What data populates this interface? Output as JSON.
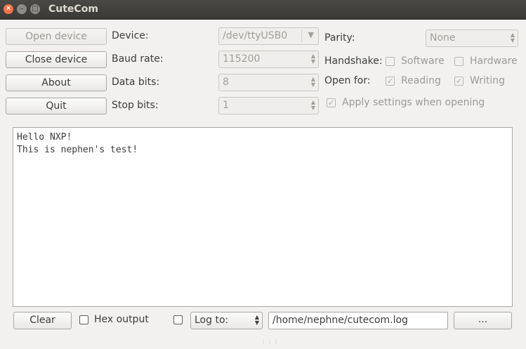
{
  "window": {
    "title": "CuteCom"
  },
  "buttons": {
    "open_device": "Open device",
    "close_device": "Close device",
    "about": "About",
    "quit": "Quit",
    "clear": "Clear",
    "browse": "..."
  },
  "settings": {
    "device_label": "Device:",
    "device_value": "/dev/ttyUSB0",
    "baud_label": "Baud rate:",
    "baud_value": "115200",
    "databits_label": "Data bits:",
    "databits_value": "8",
    "stopbits_label": "Stop bits:",
    "stopbits_value": "1",
    "parity_label": "Parity:",
    "parity_value": "None",
    "handshake_label": "Handshake:",
    "handshake_software": "Software",
    "handshake_hardware": "Hardware",
    "openfor_label": "Open for:",
    "openfor_reading": "Reading",
    "openfor_writing": "Writing",
    "apply_settings": "Apply settings when opening"
  },
  "output": {
    "lines": "Hello NXP!\nThis is nephen's test!"
  },
  "bottom": {
    "hex_output": "Hex output",
    "log_to": "Log to:",
    "log_path": "/home/nephne/cutecom.log"
  }
}
